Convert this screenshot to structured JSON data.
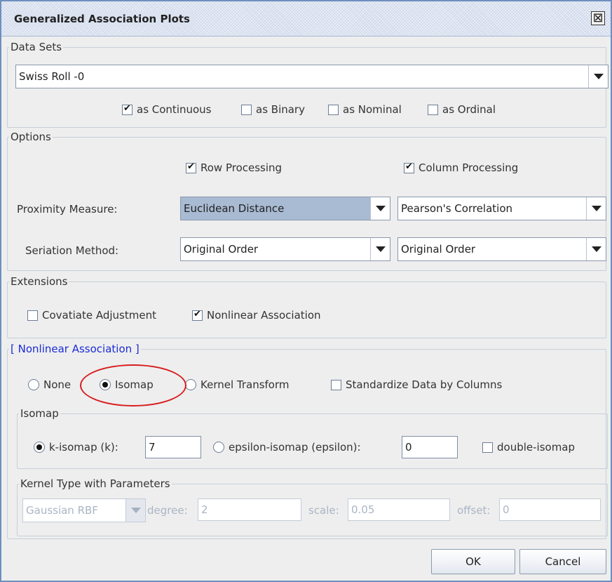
{
  "window": {
    "title": "Generalized Association Plots"
  },
  "data_sets": {
    "legend": "Data Sets",
    "dataset_value": "Swiss Roll -0",
    "as_continuous": {
      "label": "as Continuous",
      "checked": true
    },
    "as_binary": {
      "label": "as Binary",
      "checked": false
    },
    "as_nominal": {
      "label": "as Nominal",
      "checked": false
    },
    "as_ordinal": {
      "label": "as Ordinal",
      "checked": false
    }
  },
  "options": {
    "legend": "Options",
    "row_processing": {
      "label": "Row Processing",
      "checked": true
    },
    "column_processing": {
      "label": "Column Processing",
      "checked": true
    },
    "proximity_label": "Proximity Measure:",
    "proximity_row_value": "Euclidean Distance",
    "proximity_col_value": "Pearson's Correlation",
    "seriation_label": "Seriation Method:",
    "seriation_row_value": "Original Order",
    "seriation_col_value": "Original Order"
  },
  "extensions": {
    "legend": "Extensions",
    "covariate": {
      "label": "Covatiate Adjustment",
      "checked": false
    },
    "nonlinear": {
      "label": "Nonlinear Association",
      "checked": true
    }
  },
  "nonlinear_association": {
    "legend": "[ Nonlinear Association ]",
    "none_label": "None",
    "isomap_label": "Isomap",
    "kernel_label": "Kernel Transform",
    "selected": "Isomap",
    "standardize": {
      "label": "Standardize Data by Columns",
      "checked": false
    }
  },
  "isomap": {
    "legend": "Isomap",
    "k_label": "k-isomap (k):",
    "k_value": "7",
    "epsilon_label": "epsilon-isomap (epsilon):",
    "epsilon_value": "0",
    "selected": "k-isomap",
    "double_isomap": {
      "label": "double-isomap",
      "checked": false
    }
  },
  "kernel": {
    "legend": "Kernel Type with Parameters",
    "type_value": "Gaussian RBF",
    "degree_label": "degree:",
    "degree_value": "2",
    "scale_label": "scale:",
    "scale_value": "0.05",
    "offset_label": "offset:",
    "offset_value": "0"
  },
  "buttons": {
    "ok": "OK",
    "cancel": "Cancel"
  },
  "colors": {
    "highlight": "#d81e1e",
    "legend_accent": "#1a2bd6",
    "selected_field": "#a9bbd3"
  }
}
